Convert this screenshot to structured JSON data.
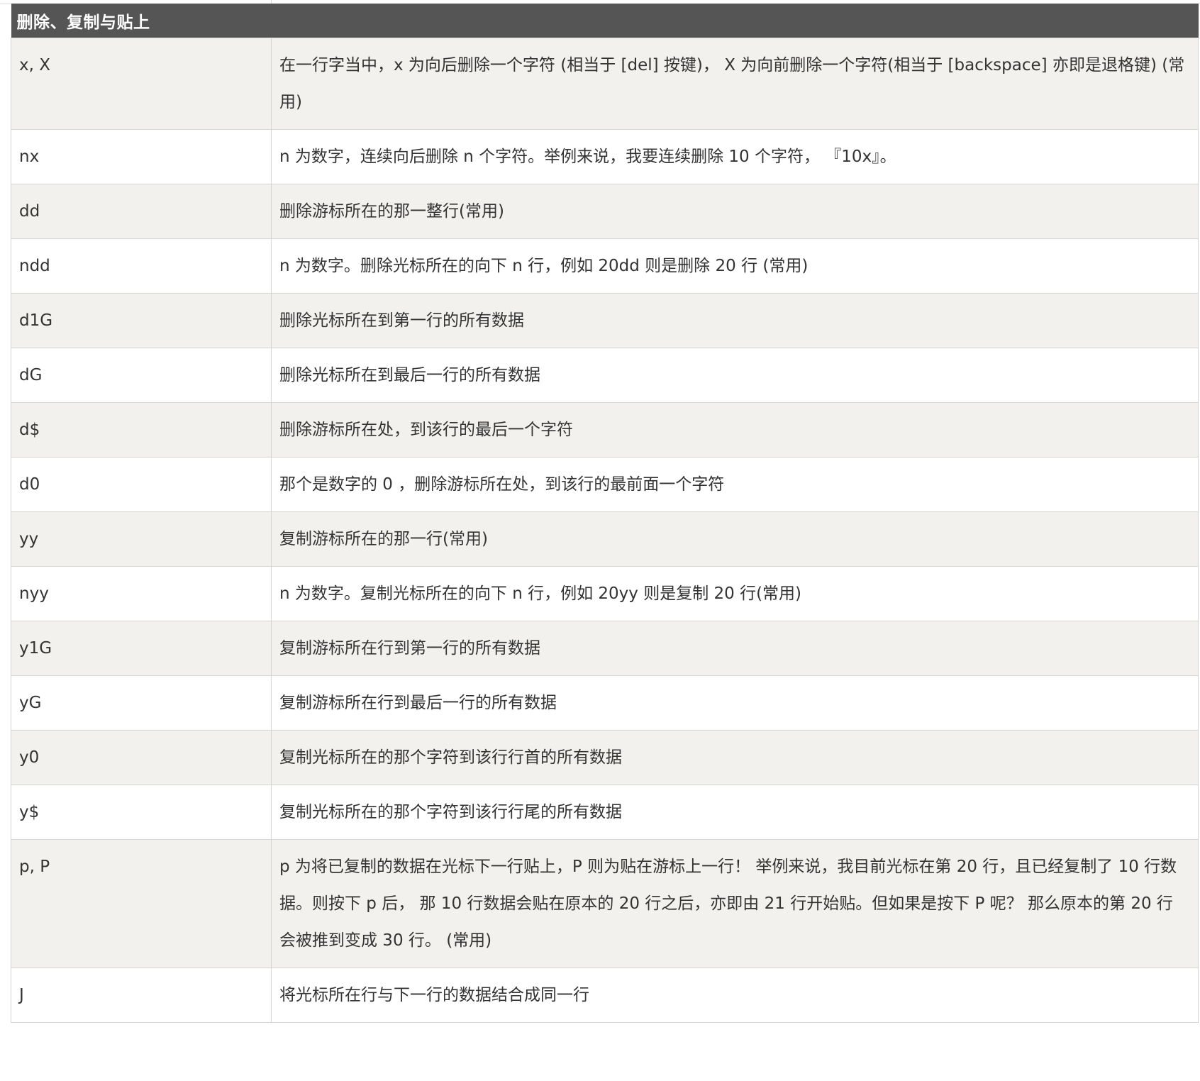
{
  "section_title": "删除、复制与贴上",
  "rows": [
    {
      "key": "x, X",
      "desc": "在一行字当中，x 为向后删除一个字符 (相当于 [del] 按键)， X 为向前删除一个字符(相当于 [backspace] 亦即是退格键) (常用)"
    },
    {
      "key": "nx",
      "desc": "n 为数字，连续向后删除 n 个字符。举例来说，我要连续删除 10 个字符， 『10x』。"
    },
    {
      "key": "dd",
      "desc": "删除游标所在的那一整行(常用)"
    },
    {
      "key": "ndd",
      "desc": "n 为数字。删除光标所在的向下 n 行，例如 20dd 则是删除 20 行 (常用)"
    },
    {
      "key": "d1G",
      "desc": "删除光标所在到第一行的所有数据"
    },
    {
      "key": "dG",
      "desc": "删除光标所在到最后一行的所有数据"
    },
    {
      "key": "d$",
      "desc": "删除游标所在处，到该行的最后一个字符"
    },
    {
      "key": "d0",
      "desc": "那个是数字的 0 ，删除游标所在处，到该行的最前面一个字符"
    },
    {
      "key": "yy",
      "desc": "复制游标所在的那一行(常用)"
    },
    {
      "key": "nyy",
      "desc": "n 为数字。复制光标所在的向下 n 行，例如 20yy 则是复制 20 行(常用)"
    },
    {
      "key": "y1G",
      "desc": "复制游标所在行到第一行的所有数据"
    },
    {
      "key": "yG",
      "desc": "复制游标所在行到最后一行的所有数据"
    },
    {
      "key": "y0",
      "desc": "复制光标所在的那个字符到该行行首的所有数据"
    },
    {
      "key": "y$",
      "desc": "复制光标所在的那个字符到该行行尾的所有数据"
    },
    {
      "key": "p, P",
      "desc": "p 为将已复制的数据在光标下一行贴上，P 则为贴在游标上一行！ 举例来说，我目前光标在第 20 行，且已经复制了 10 行数据。则按下 p 后， 那 10 行数据会贴在原本的 20 行之后，亦即由 21 行开始贴。但如果是按下 P 呢？ 那么原本的第 20 行会被推到变成 30 行。 (常用)"
    },
    {
      "key": "J",
      "desc": "将光标所在行与下一行的数据结合成同一行"
    }
  ]
}
